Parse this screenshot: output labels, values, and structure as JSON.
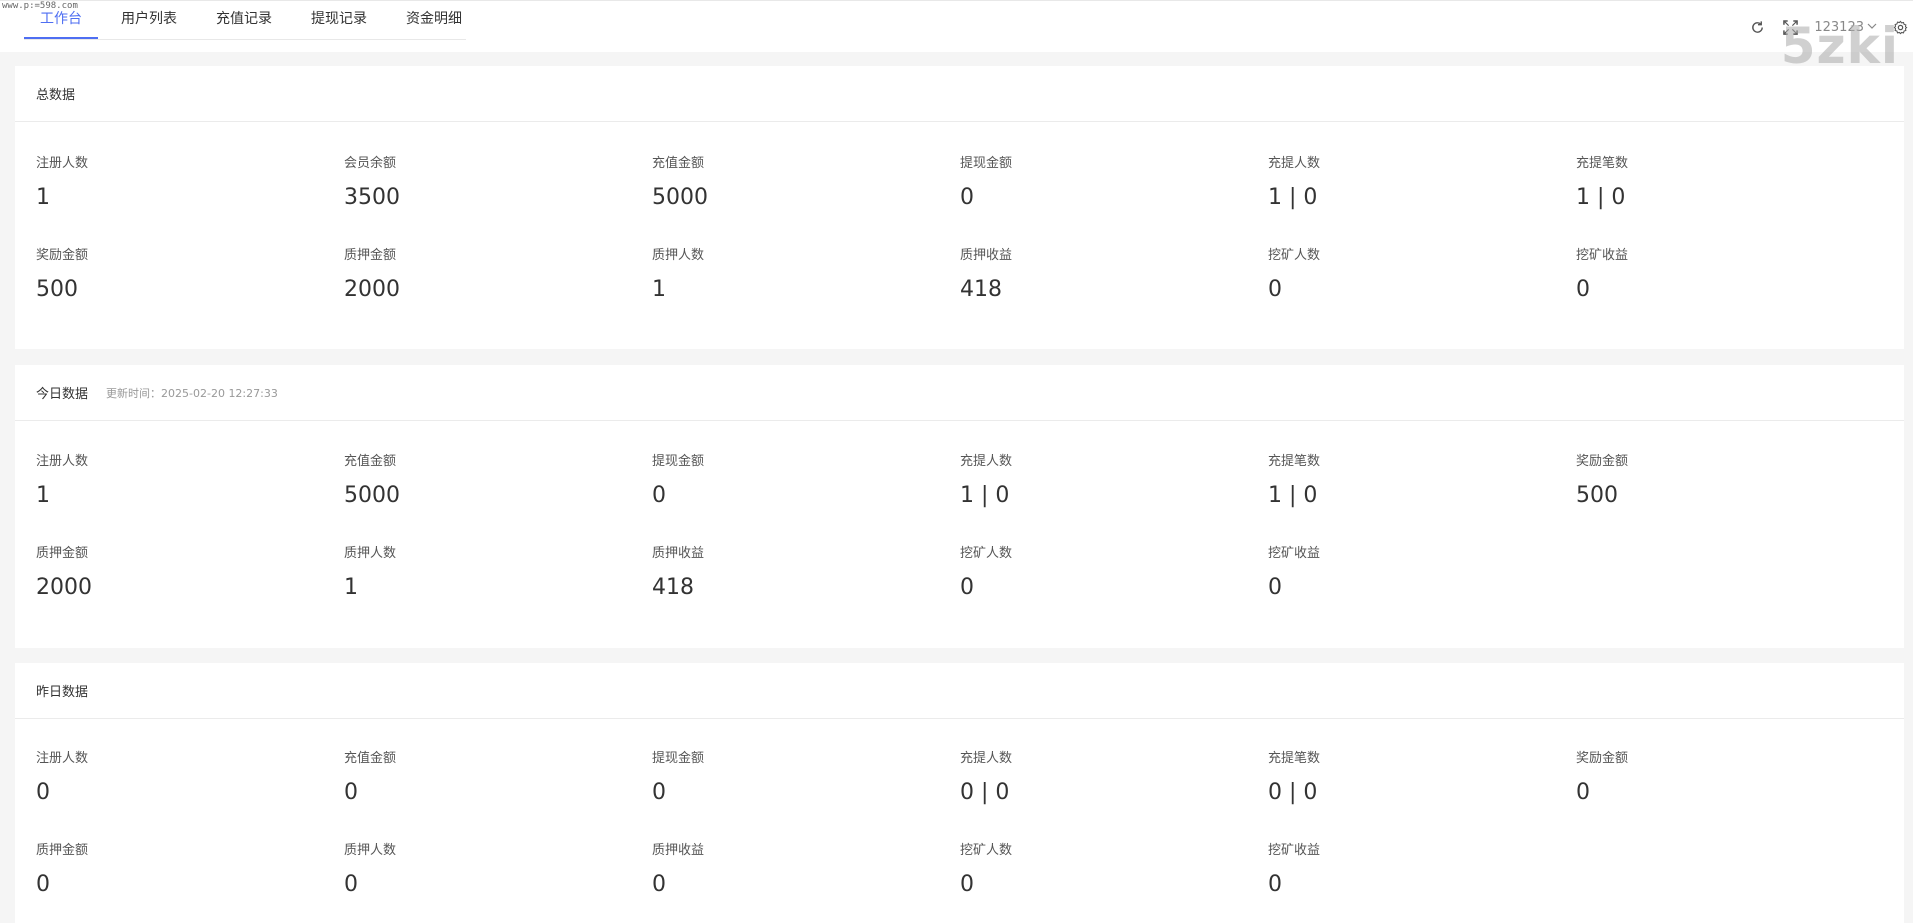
{
  "watermark_small": "www.p:=598.com",
  "watermark_big": "5zki",
  "tabs": [
    "工作台",
    "用户列表",
    "充值记录",
    "提现记录",
    "资金明细"
  ],
  "active_tab": 0,
  "user": {
    "name": "123123"
  },
  "icons": [
    "refresh-icon",
    "fullscreen-icon",
    "chevron-down-icon",
    "settings-icon"
  ],
  "accent_color": "#4e6ef2",
  "total": {
    "title": "总数据",
    "stats": [
      {
        "label": "注册人数",
        "value": "1"
      },
      {
        "label": "会员余额",
        "value": "3500"
      },
      {
        "label": "充值金额",
        "value": "5000"
      },
      {
        "label": "提现金额",
        "value": "0"
      },
      {
        "label": "充提人数",
        "value": "1 | 0"
      },
      {
        "label": "充提笔数",
        "value": "1 | 0"
      },
      {
        "label": "奖励金额",
        "value": "500"
      },
      {
        "label": "质押金额",
        "value": "2000"
      },
      {
        "label": "质押人数",
        "value": "1"
      },
      {
        "label": "质押收益",
        "value": "418"
      },
      {
        "label": "挖矿人数",
        "value": "0"
      },
      {
        "label": "挖矿收益",
        "value": "0"
      }
    ]
  },
  "today": {
    "title": "今日数据",
    "updated": "更新时间：2025-02-20 12:27:33",
    "stats": [
      {
        "label": "注册人数",
        "value": "1"
      },
      {
        "label": "充值金额",
        "value": "5000"
      },
      {
        "label": "提现金额",
        "value": "0"
      },
      {
        "label": "充提人数",
        "value": "1 | 0"
      },
      {
        "label": "充提笔数",
        "value": "1 | 0"
      },
      {
        "label": "奖励金额",
        "value": "500"
      },
      {
        "label": "质押金额",
        "value": "2000"
      },
      {
        "label": "质押人数",
        "value": "1"
      },
      {
        "label": "质押收益",
        "value": "418"
      },
      {
        "label": "挖矿人数",
        "value": "0"
      },
      {
        "label": "挖矿收益",
        "value": "0"
      }
    ]
  },
  "yesterday": {
    "title": "昨日数据",
    "stats": [
      {
        "label": "注册人数",
        "value": "0"
      },
      {
        "label": "充值金额",
        "value": "0"
      },
      {
        "label": "提现金额",
        "value": "0"
      },
      {
        "label": "充提人数",
        "value": "0 | 0"
      },
      {
        "label": "充提笔数",
        "value": "0 | 0"
      },
      {
        "label": "奖励金额",
        "value": "0"
      },
      {
        "label": "质押金额",
        "value": "0"
      },
      {
        "label": "质押人数",
        "value": "0"
      },
      {
        "label": "质押收益",
        "value": "0"
      },
      {
        "label": "挖矿人数",
        "value": "0"
      },
      {
        "label": "挖矿收益",
        "value": "0"
      }
    ]
  }
}
